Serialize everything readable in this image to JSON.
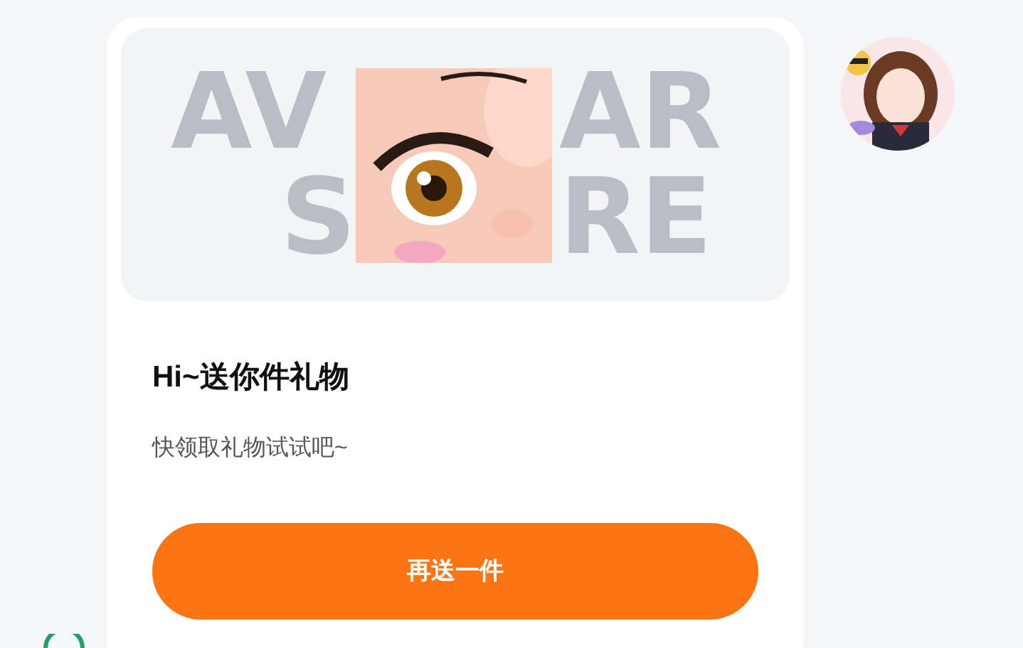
{
  "banner": {
    "bg_text": [
      {
        "left": "AV",
        "right": "AR"
      },
      {
        "left": "S",
        "right": "RE"
      }
    ]
  },
  "title": "Hi~送你件礼物",
  "subtitle": "快领取礼物试试吧~",
  "button": "再送一件"
}
